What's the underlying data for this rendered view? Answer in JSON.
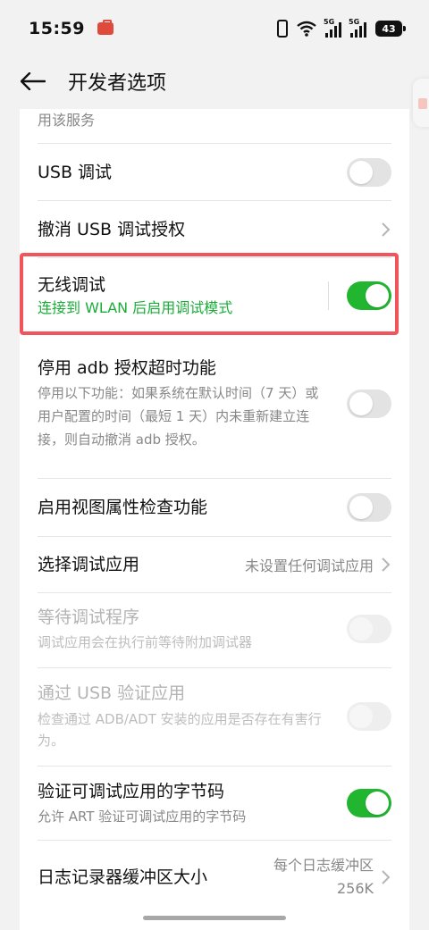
{
  "status_bar": {
    "time": "15:59",
    "battery": "43",
    "network_label_1": "5G",
    "network_label_2": "5G"
  },
  "app_bar": {
    "title": "开发者选项"
  },
  "settings": {
    "partial_row": {
      "title": "用该服务"
    },
    "usb_debugging": {
      "title": "USB 调试",
      "enabled": false
    },
    "revoke_usb_auth": {
      "title": "撤消 USB 调试授权"
    },
    "wireless_debugging": {
      "title": "无线调试",
      "subtitle": "连接到 WLAN 后启用调试模式",
      "enabled": true
    },
    "disable_adb_timeout": {
      "title": "停用 adb 授权超时功能",
      "subtitle": "停用以下功能：如果系统在默认时间（7 天）或用户配置的时间（最短 1 天）内未重新建立连接，则自动撤消 adb 授权。",
      "enabled": false
    },
    "view_attribute_inspection": {
      "title": "启用视图属性检查功能",
      "enabled": false
    },
    "select_debug_app": {
      "title": "选择调试应用",
      "value": "未设置任何调试应用"
    },
    "wait_for_debugger": {
      "title": "等待调试程序",
      "subtitle": "调试应用会在执行前等待附加调试器",
      "enabled": false,
      "disabled": true
    },
    "verify_apps_usb": {
      "title": "通过 USB 验证应用",
      "subtitle": "检查通过 ADB/ADT 安装的应用是否存在有害行为。",
      "enabled": false,
      "disabled": true
    },
    "verify_bytecode": {
      "title": "验证可调试应用的字节码",
      "subtitle": "允许 ART 验证可调试应用的字节码",
      "enabled": true
    },
    "logger_buffer": {
      "title": "日志记录器缓冲区大小",
      "value_line1": "每个日志缓冲区",
      "value_line2": "256K"
    }
  },
  "colors": {
    "accent_green": "#1aad3a",
    "toggle_on": "#22b530",
    "highlight_red": "#f2545b"
  }
}
